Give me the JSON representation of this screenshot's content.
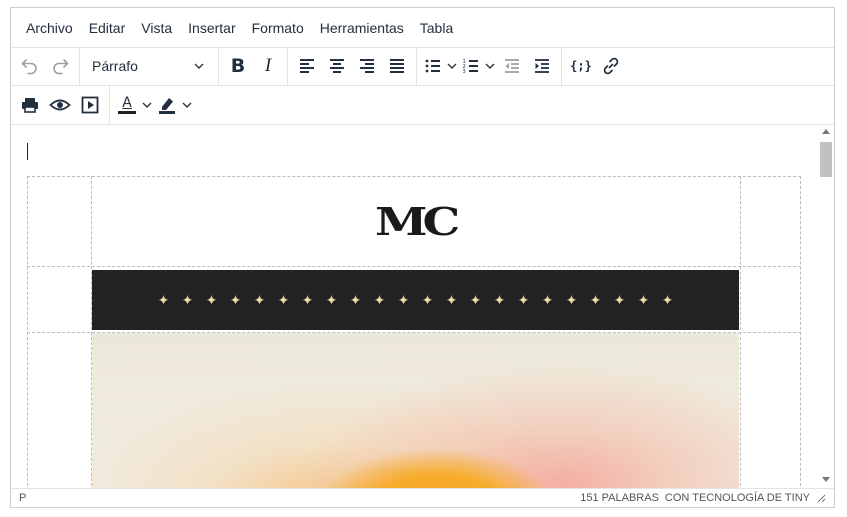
{
  "menubar": {
    "items": [
      "Archivo",
      "Editar",
      "Vista",
      "Insertar",
      "Formato",
      "Herramientas",
      "Tabla"
    ]
  },
  "toolbar": {
    "block_format": "Párrafo",
    "icons_row1": [
      "undo-icon",
      "redo-icon",
      "bold-icon",
      "italic-icon",
      "align-left-icon",
      "align-center-icon",
      "align-right-icon",
      "align-justify-icon",
      "bullet-list-icon",
      "numbered-list-icon",
      "outdent-icon",
      "indent-icon",
      "code-sample-icon",
      "link-icon"
    ],
    "icons_row2": [
      "print-icon",
      "preview-icon",
      "media-icon",
      "text-color-icon",
      "highlight-color-icon"
    ],
    "bold_label": "B",
    "italic_label": "I",
    "text_color_label": "A",
    "code_label": "{;}",
    "text_color": "#222f3e"
  },
  "content": {
    "logo_text": "MC",
    "stars": [
      "✦",
      "✦",
      "✦",
      "✦",
      "✦",
      "✦",
      "✦",
      "✦",
      "✦",
      "✦",
      "✦",
      "✦",
      "✦",
      "✦",
      "✦",
      "✦",
      "✦",
      "✦",
      "✦",
      "✦",
      "✦",
      "✦"
    ],
    "band_color": "#232323",
    "star_color": "#e9dca0"
  },
  "statusbar": {
    "path": "P",
    "word_count": "151 PALABRAS",
    "branding": "CON TECNOLOGÍA DE TINY"
  }
}
